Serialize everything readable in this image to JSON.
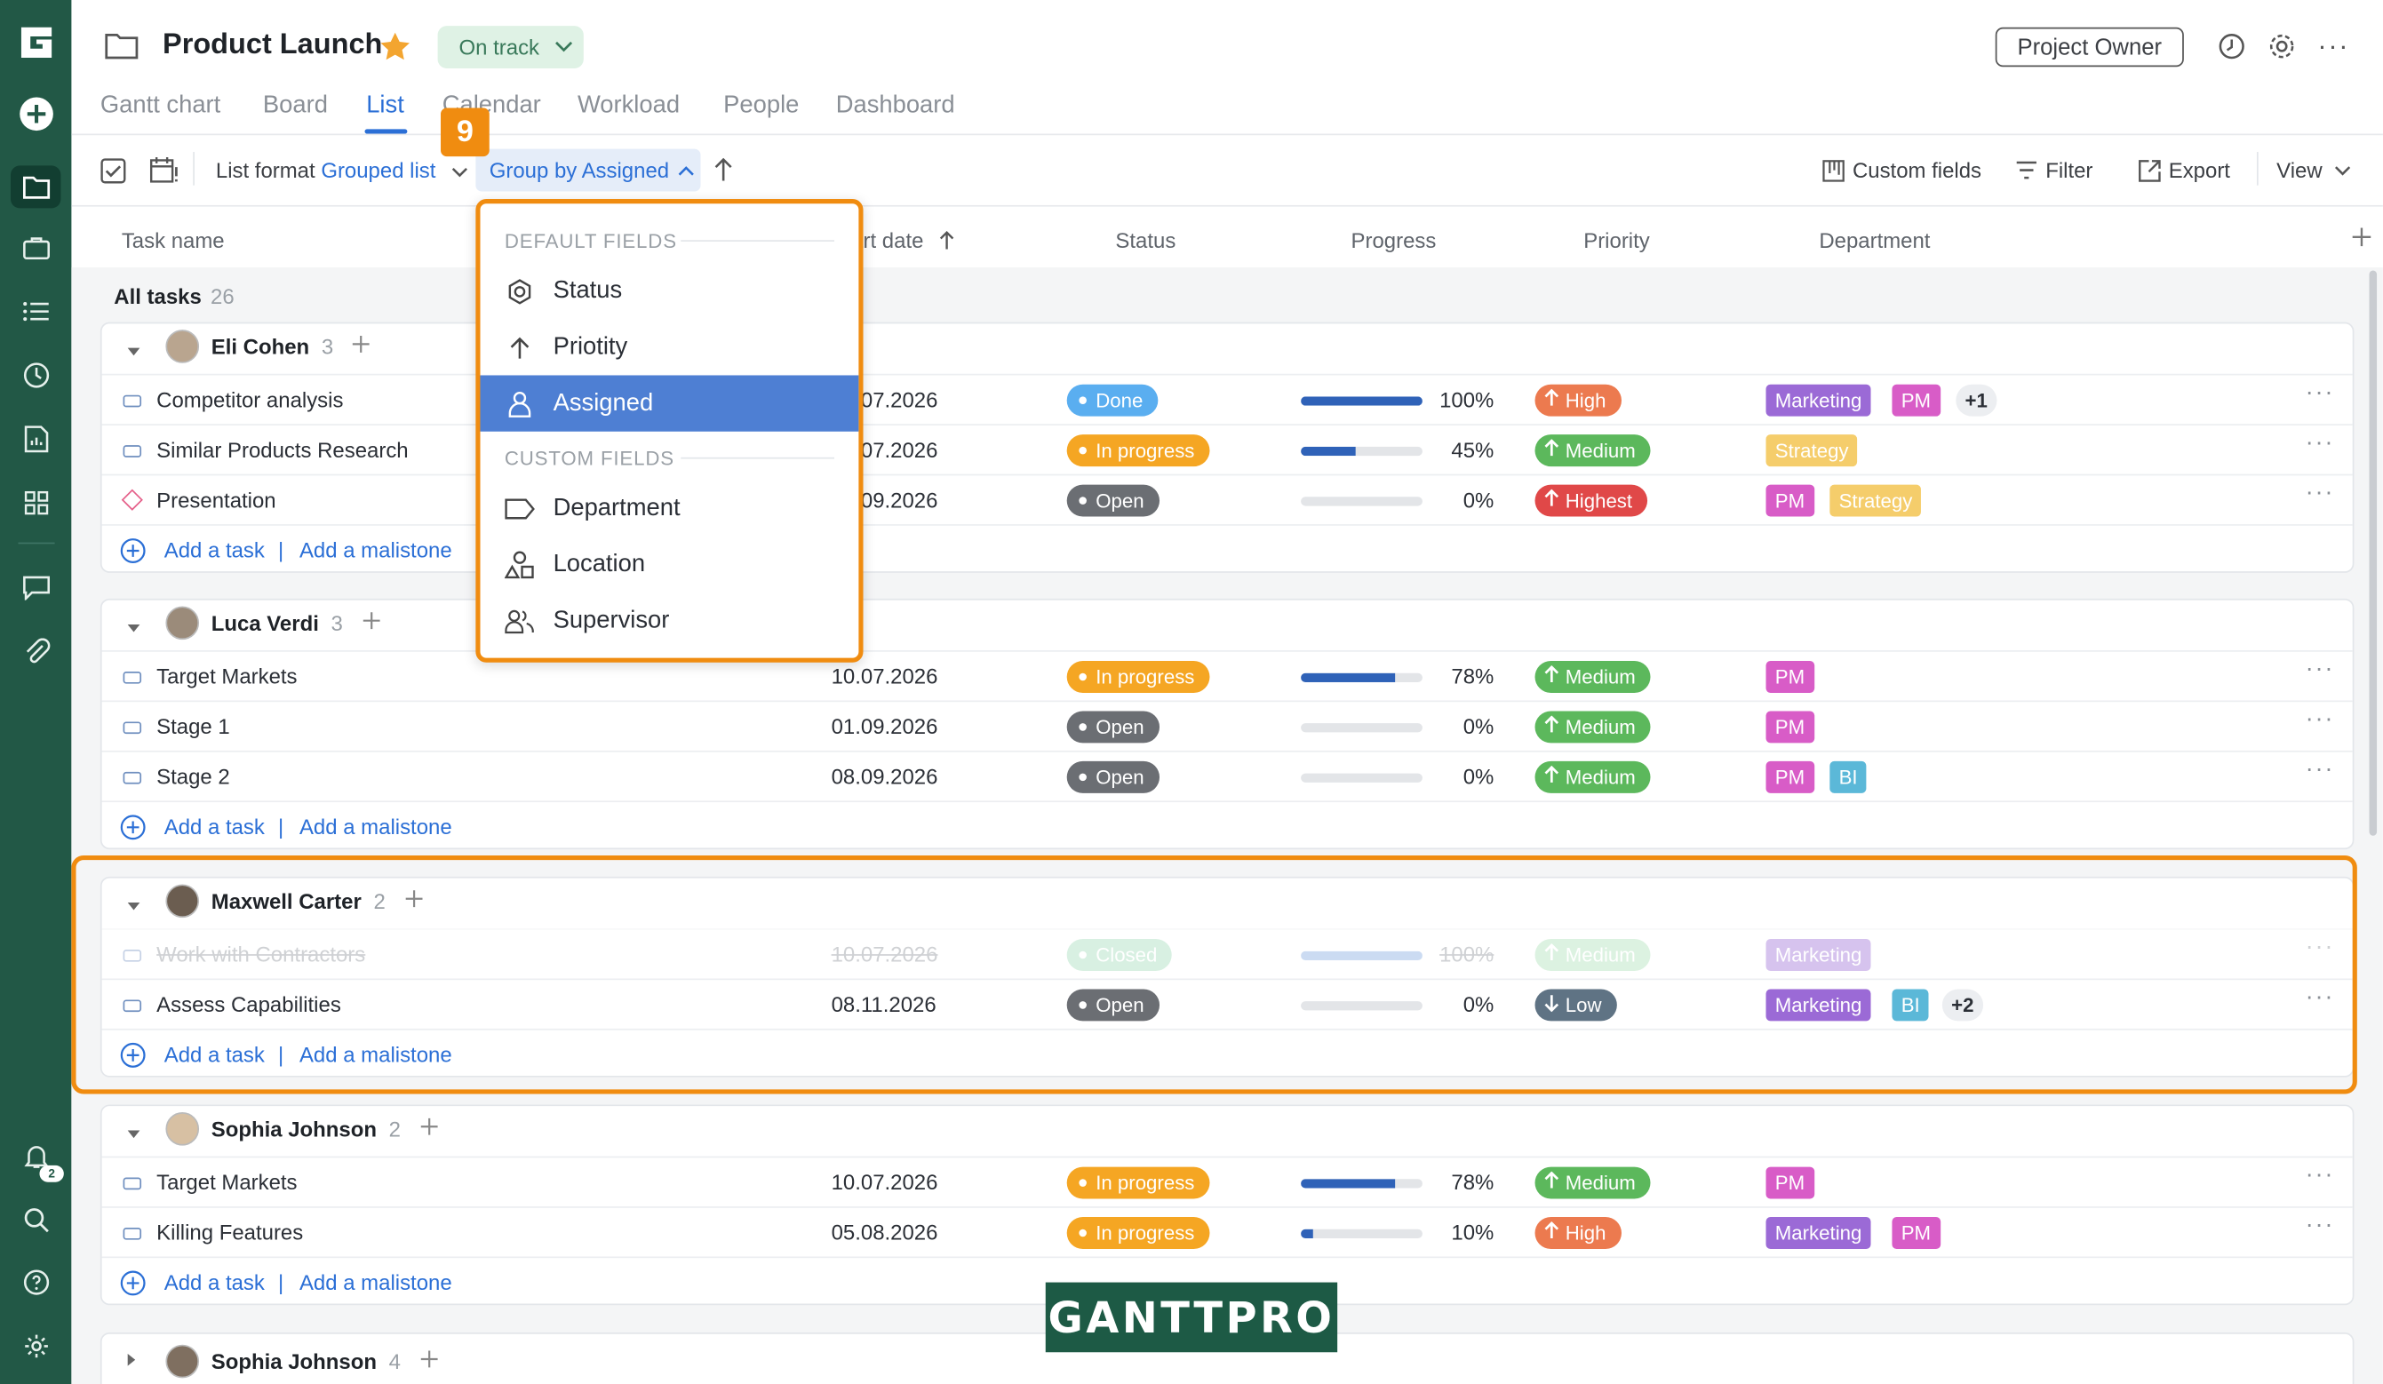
{
  "project": {
    "title": "Product Launch",
    "status": "On track",
    "role": "Project Owner"
  },
  "tabs": [
    {
      "label": "Gantt chart"
    },
    {
      "label": "Board"
    },
    {
      "label": "List"
    },
    {
      "label": "Calendar"
    },
    {
      "label": "Workload"
    },
    {
      "label": "People"
    },
    {
      "label": "Dashboard"
    }
  ],
  "toolbar": {
    "list_format_label": "List format",
    "list_format_value": "Grouped list",
    "group_by": "Group by Assigned",
    "custom_fields": "Custom fields",
    "filter": "Filter",
    "export": "Export",
    "view": "View",
    "step_marker": "9"
  },
  "columns": {
    "task_name": "Task name",
    "start_date": "Start date",
    "status": "Status",
    "progress": "Progress",
    "priority": "Priority",
    "department": "Department"
  },
  "all_tasks": {
    "label": "All tasks",
    "count": "26"
  },
  "add_task": "Add a task",
  "add_milestone": "Add a malistone",
  "groups": [
    {
      "name": "Eli Cohen",
      "count": "3",
      "tasks": [
        {
          "name": "Competitor analysis",
          "date": "01.07.2026",
          "status": "Done",
          "progress": "100%",
          "priority": "High",
          "tags": [
            "Marketing",
            "PM",
            "+1"
          ]
        },
        {
          "name": "Similar Products Research",
          "date": "07.07.2026",
          "status": "In progress",
          "progress": "45%",
          "priority": "Medium",
          "tags": [
            "Strategy"
          ]
        },
        {
          "name": "Presentation",
          "date": "09.09.2026",
          "status": "Open",
          "progress": "0%",
          "priority": "Highest",
          "tags": [
            "PM",
            "Strategy"
          ]
        }
      ]
    },
    {
      "name": "Luca Verdi",
      "count": "3",
      "tasks": [
        {
          "name": "Target Markets",
          "date": "10.07.2026",
          "status": "In progress",
          "progress": "78%",
          "priority": "Medium",
          "tags": [
            "PM"
          ]
        },
        {
          "name": "Stage 1",
          "date": "01.09.2026",
          "status": "Open",
          "progress": "0%",
          "priority": "Medium",
          "tags": [
            "PM"
          ]
        },
        {
          "name": "Stage 2",
          "date": "08.09.2026",
          "status": "Open",
          "progress": "0%",
          "priority": "Medium",
          "tags": [
            "PM",
            "BI"
          ]
        }
      ]
    },
    {
      "name": "Maxwell Carter",
      "count": "2",
      "tasks": [
        {
          "name": "Work with Contractors",
          "date": "10.07.2026",
          "status": "Closed",
          "progress": "100%",
          "priority": "Medium",
          "tags": [
            "Marketing"
          ]
        },
        {
          "name": "Assess Capabilities",
          "date": "08.11.2026",
          "status": "Open",
          "progress": "0%",
          "priority": "Low",
          "tags": [
            "Marketing",
            "BI",
            "+2"
          ]
        }
      ]
    },
    {
      "name": "Sophia Johnson",
      "count": "2",
      "tasks": [
        {
          "name": "Target Markets",
          "date": "10.07.2026",
          "status": "In progress",
          "progress": "78%",
          "priority": "Medium",
          "tags": [
            "PM"
          ]
        },
        {
          "name": "Killing Features",
          "date": "05.08.2026",
          "status": "In progress",
          "progress": "10%",
          "priority": "High",
          "tags": [
            "Marketing",
            "PM"
          ]
        }
      ]
    },
    {
      "name": "Sophia Johnson",
      "count": "4",
      "tasks": []
    }
  ],
  "dropdown": {
    "default_label": "DEFAULT FIELDS",
    "custom_label": "CUSTOM FIELDS",
    "default_items": [
      {
        "label": "Status"
      },
      {
        "label": "Priotity"
      },
      {
        "label": "Assigned"
      }
    ],
    "custom_items": [
      {
        "label": "Department"
      },
      {
        "label": "Location"
      },
      {
        "label": "Supervisor"
      }
    ]
  },
  "notifications_count": "2",
  "watermark": "GANTTPRO",
  "colors": {
    "sidebar": "#225846",
    "accent": "#2b6fd6",
    "highlight": "#f08c10",
    "status": {
      "Done": "#5aaef0",
      "In progress": "#f5a623",
      "Open": "#6b6e73",
      "Closed": "#9fdcb8"
    },
    "priority": {
      "High": "#ec7a4f",
      "Highest": "#e04848",
      "Medium": "#5cb85c",
      "Low": "#5f7384"
    },
    "tags": {
      "Marketing": "#9b6ad6",
      "PM": "#d85cc7",
      "Strategy": "#f5cd6b",
      "BI": "#5bb8d8",
      "+1": "#eceef1",
      "+2": "#eceef1"
    }
  },
  "progress_values": [
    1,
    0.45,
    0,
    0.78,
    0,
    0,
    1,
    0,
    0.78,
    0.1
  ]
}
